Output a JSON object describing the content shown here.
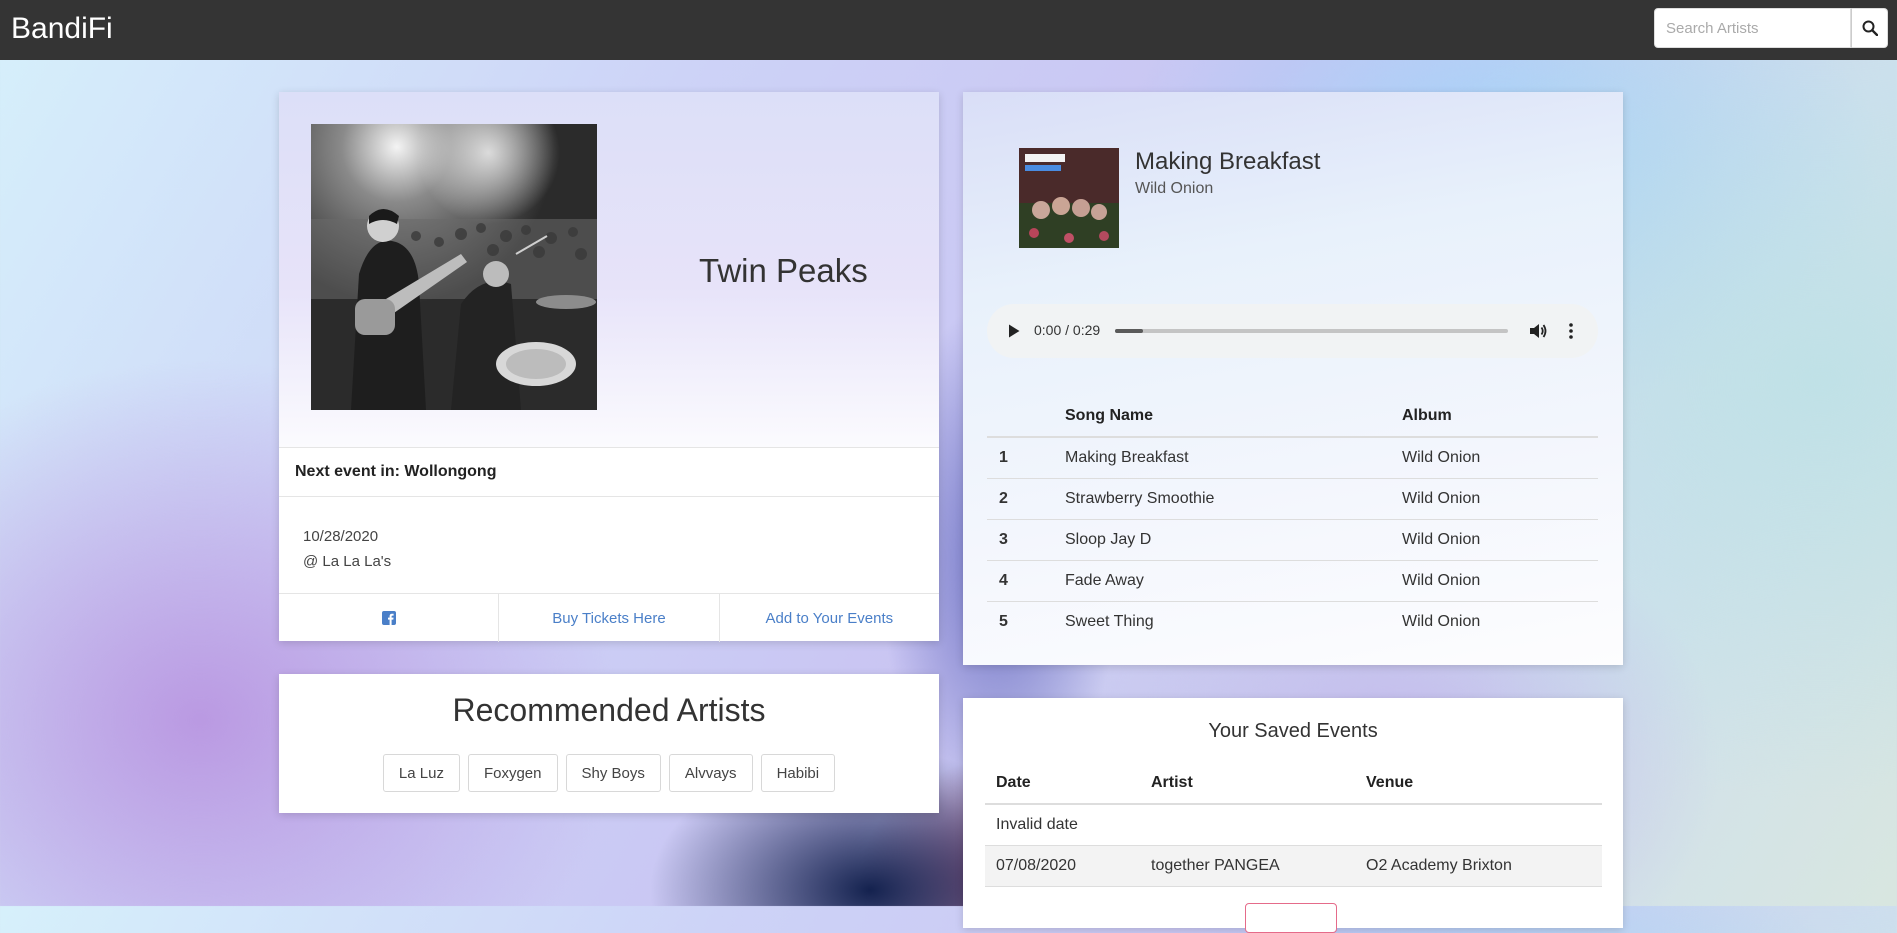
{
  "app": {
    "brand": "BandiFi"
  },
  "search": {
    "placeholder": "Search Artists",
    "icon": "search-icon"
  },
  "artist": {
    "name": "Twin Peaks",
    "next_event_label": "Next event in: Wollongong",
    "event_date": "10/28/2020",
    "event_venue": "@ La La La's",
    "actions": {
      "facebook_icon": "facebook-square-icon",
      "buy_tickets": "Buy Tickets Here",
      "add_event": "Add to Your Events"
    },
    "accent_color": "#4a7fc8"
  },
  "recommended": {
    "title": "Recommended Artists",
    "artists": [
      "La Luz",
      "Foxygen",
      "Shy Boys",
      "Alvvays",
      "Habibi"
    ]
  },
  "player": {
    "song_title": "Making Breakfast",
    "album": "Wild Onion",
    "time": "0:00 / 0:29",
    "progress": 0.07,
    "columns": [
      "",
      "Song Name",
      "Album"
    ],
    "songs": [
      {
        "num": "1",
        "name": "Making Breakfast",
        "album": "Wild Onion"
      },
      {
        "num": "2",
        "name": "Strawberry Smoothie",
        "album": "Wild Onion"
      },
      {
        "num": "3",
        "name": "Sloop Jay D",
        "album": "Wild Onion"
      },
      {
        "num": "4",
        "name": "Fade Away",
        "album": "Wild Onion"
      },
      {
        "num": "5",
        "name": "Sweet Thing",
        "album": "Wild Onion"
      }
    ]
  },
  "saved_events": {
    "title": "Your Saved Events",
    "columns": [
      "Date",
      "Artist",
      "Venue"
    ],
    "rows": [
      {
        "date": "Invalid date",
        "artist": "",
        "venue": ""
      },
      {
        "date": "07/08/2020",
        "artist": "together PANGEA",
        "venue": "O2 Academy Brixton"
      }
    ]
  }
}
